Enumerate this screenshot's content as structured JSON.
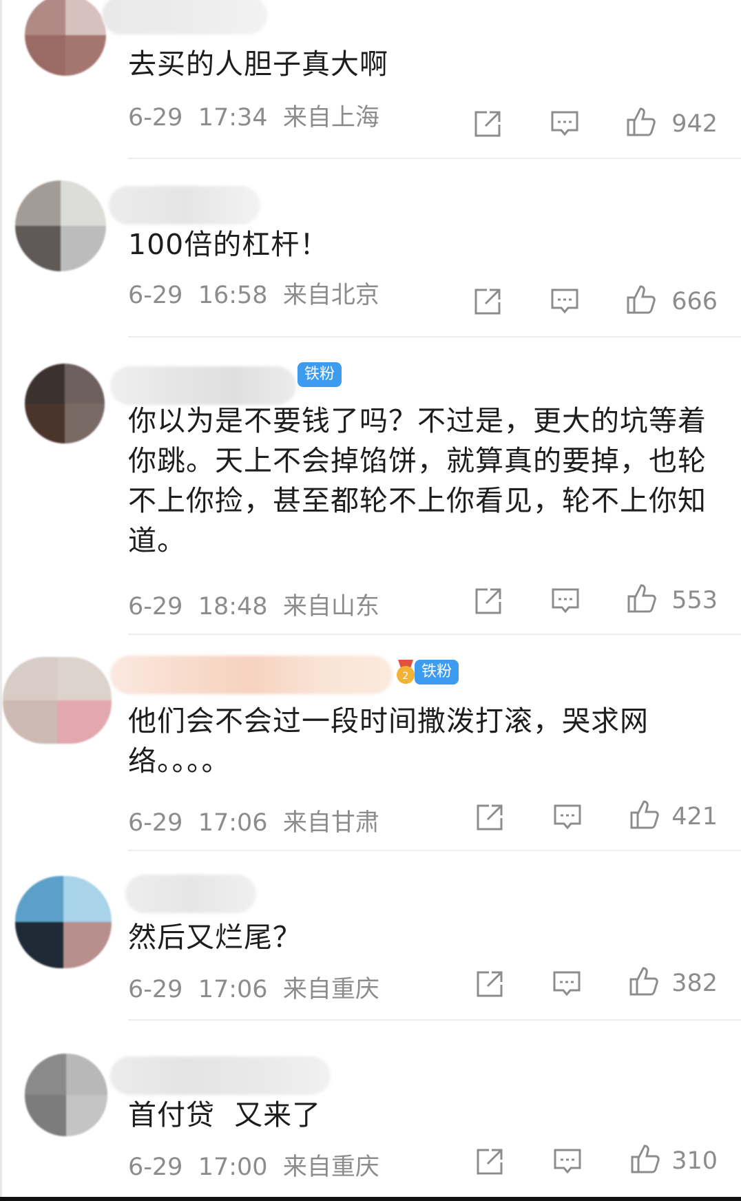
{
  "comments": [
    {
      "text": "去买的人胆子真大啊",
      "date": "6-29",
      "time": "17:34",
      "location": "来自上海",
      "likes": "942",
      "badge": ""
    },
    {
      "text": "100倍的杠杆！",
      "date": "6-29",
      "time": "16:58",
      "location": "来自北京",
      "likes": "666",
      "badge": ""
    },
    {
      "text": "你以为是不要钱了吗？不过是，更大的坑等着你跳。天上不会掉馅饼，就算真的要掉，也轮不上你捡，甚至都轮不上你看见，轮不上你知道。",
      "date": "6-29",
      "time": "18:48",
      "location": "来自山东",
      "likes": "553",
      "badge": "铁粉"
    },
    {
      "text": "他们会不会过一段时间撒泼打滚，哭求网络。。。。",
      "date": "6-29",
      "time": "17:06",
      "location": "来自甘肃",
      "likes": "421",
      "badge": "铁粉"
    },
    {
      "text": "然后又烂尾？",
      "date": "6-29",
      "time": "17:06",
      "location": "来自重庆",
      "likes": "382",
      "badge": ""
    },
    {
      "text": "首付贷  又来了",
      "date": "6-29",
      "time": "17:00",
      "location": "来自重庆",
      "likes": "310",
      "badge": ""
    }
  ],
  "icons": {
    "share": "share-icon",
    "reply": "comment-icon",
    "like": "thumbs-up-icon"
  },
  "colors": {
    "meta": "#8c8c8c",
    "badge": "#3d9cf0",
    "divider": "#eeeeee"
  }
}
